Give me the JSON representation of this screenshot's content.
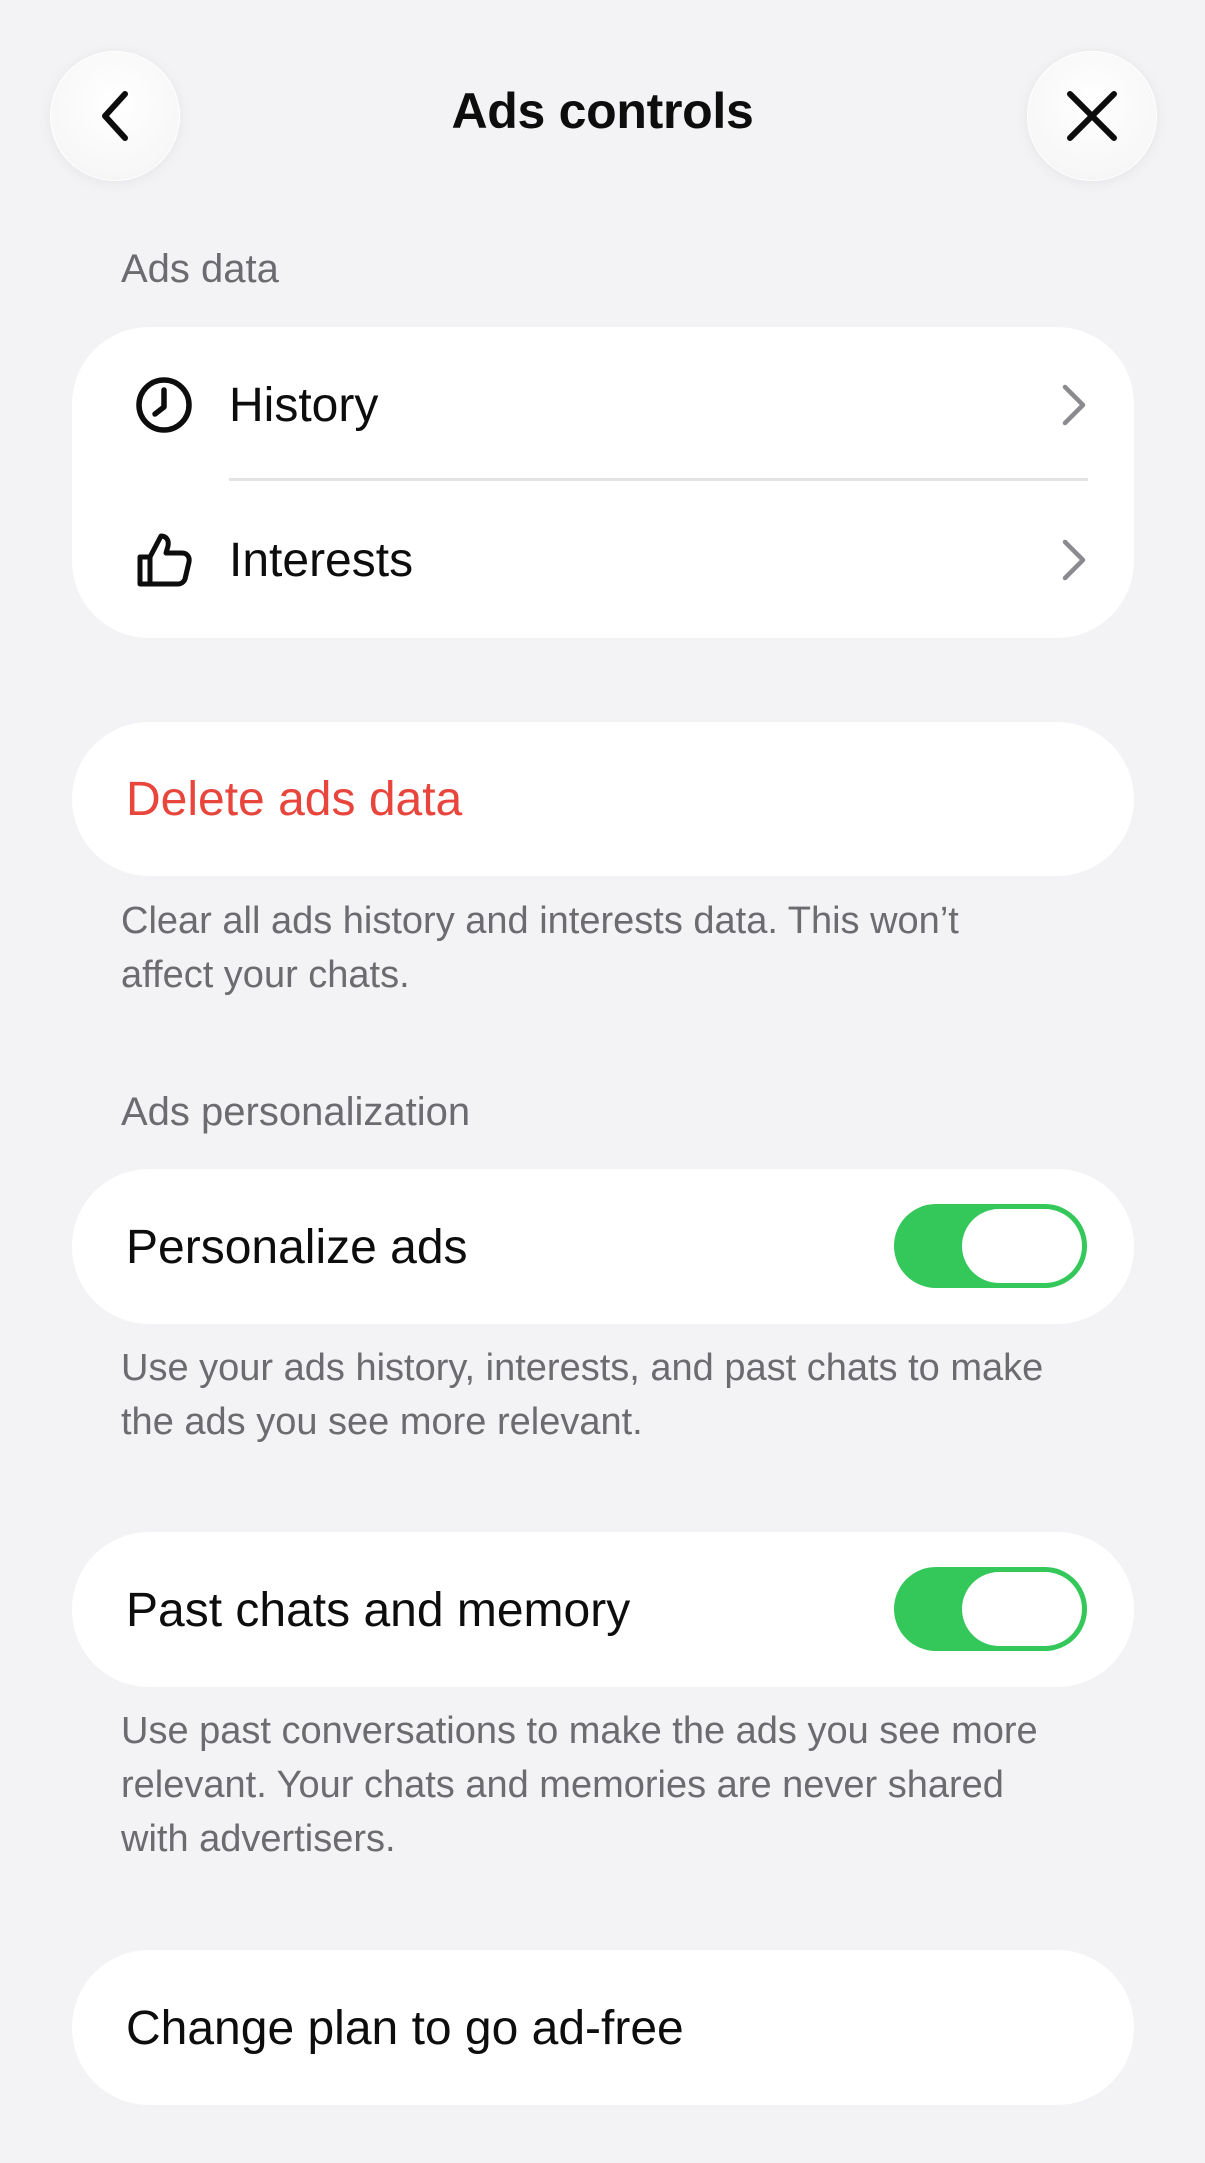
{
  "header": {
    "title": "Ads controls",
    "back_icon": "chevron-left-icon",
    "close_icon": "close-icon"
  },
  "ads_data": {
    "section_label": "Ads data",
    "items": [
      {
        "label": "History",
        "icon": "clock-icon"
      },
      {
        "label": "Interests",
        "icon": "thumbs-up-icon"
      }
    ]
  },
  "delete": {
    "label": "Delete ads data",
    "description": "Clear all ads history and interests data. This won’t affect your chats.",
    "color": "#e8453c"
  },
  "personalization": {
    "section_label": "Ads personalization",
    "personalize": {
      "label": "Personalize ads",
      "enabled": true,
      "description": "Use your ads history, interests, and past chats to make the ads you see more relevant."
    },
    "past_chats": {
      "label": "Past chats and memory",
      "enabled": true,
      "description": "Use past conversations to make the ads you see more relevant. Your chats and memories are never shared with advertisers."
    },
    "toggle_color": "#34c759"
  },
  "plan": {
    "label": "Change plan to go ad-free"
  }
}
